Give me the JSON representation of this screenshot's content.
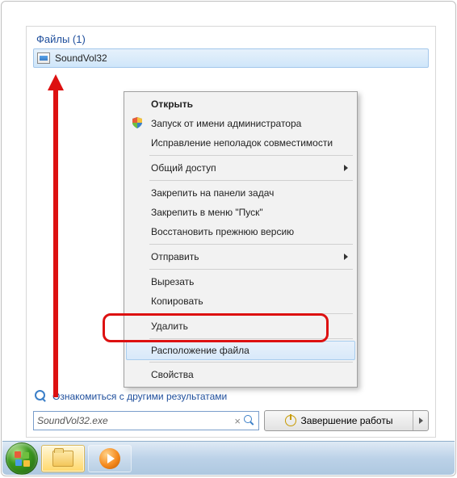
{
  "files_header": "Файлы (1)",
  "result_filename": "SoundVol32",
  "context_menu": {
    "open": "Открыть",
    "run_as_admin": "Запуск от имени администратора",
    "troubleshoot": "Исправление неполадок совместимости",
    "share": "Общий доступ",
    "pin_taskbar": "Закрепить на панели задач",
    "pin_start": "Закрепить в меню \"Пуск\"",
    "restore": "Восстановить прежнюю версию",
    "send_to": "Отправить",
    "cut": "Вырезать",
    "copy": "Копировать",
    "delete": "Удалить",
    "file_location": "Расположение файла",
    "properties": "Свойства"
  },
  "more_results": "Ознакомиться с другими результатами",
  "search_value": "SoundVol32.exe",
  "shutdown_label": "Завершение работы"
}
